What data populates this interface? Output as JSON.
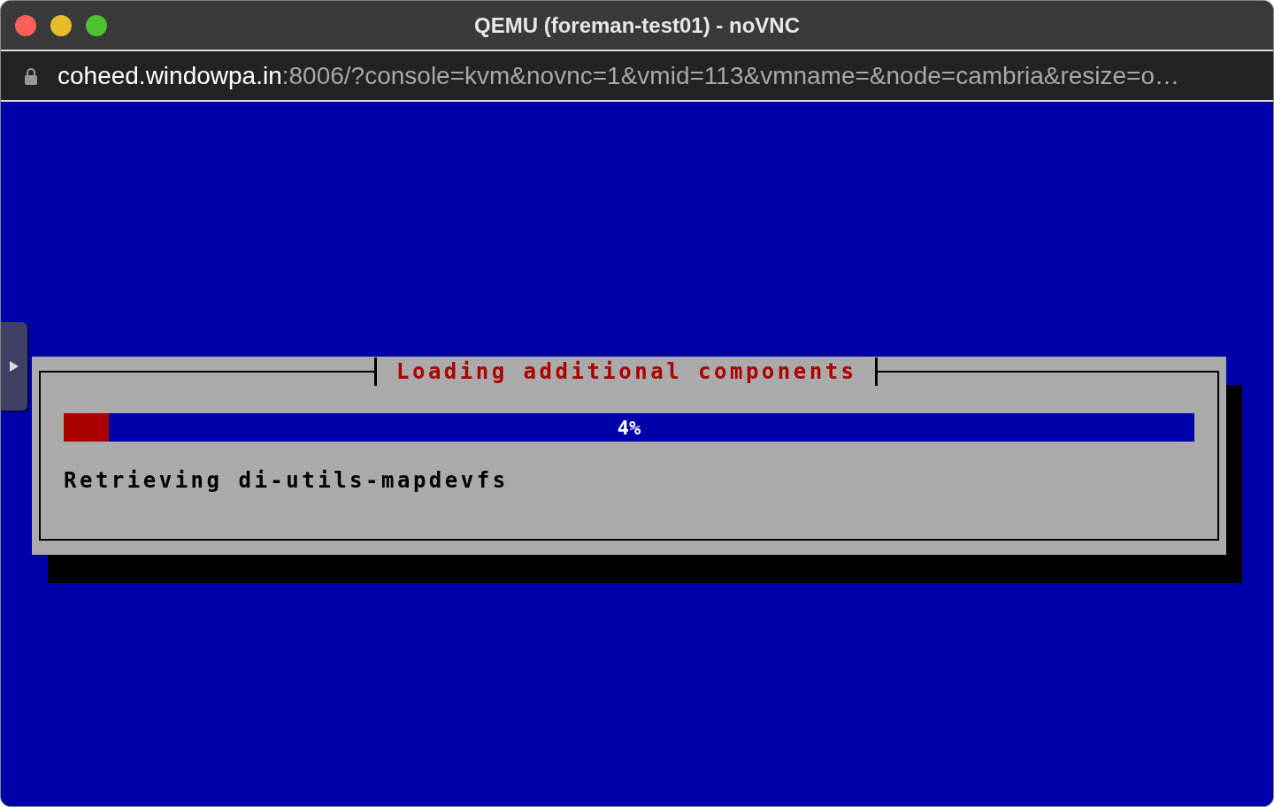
{
  "window": {
    "title": "QEMU (foreman-test01) - noVNC"
  },
  "address_bar": {
    "host": "coheed.windowpa.in",
    "rest": ":8006/?console=kvm&novnc=1&vmid=113&vmname=&node=cambria&resize=o…"
  },
  "dialog": {
    "title": "Loading additional components",
    "progress": {
      "level": 0.04,
      "reading": "4%"
    },
    "message": "Retrieving di-utils-mapdevfs"
  }
}
